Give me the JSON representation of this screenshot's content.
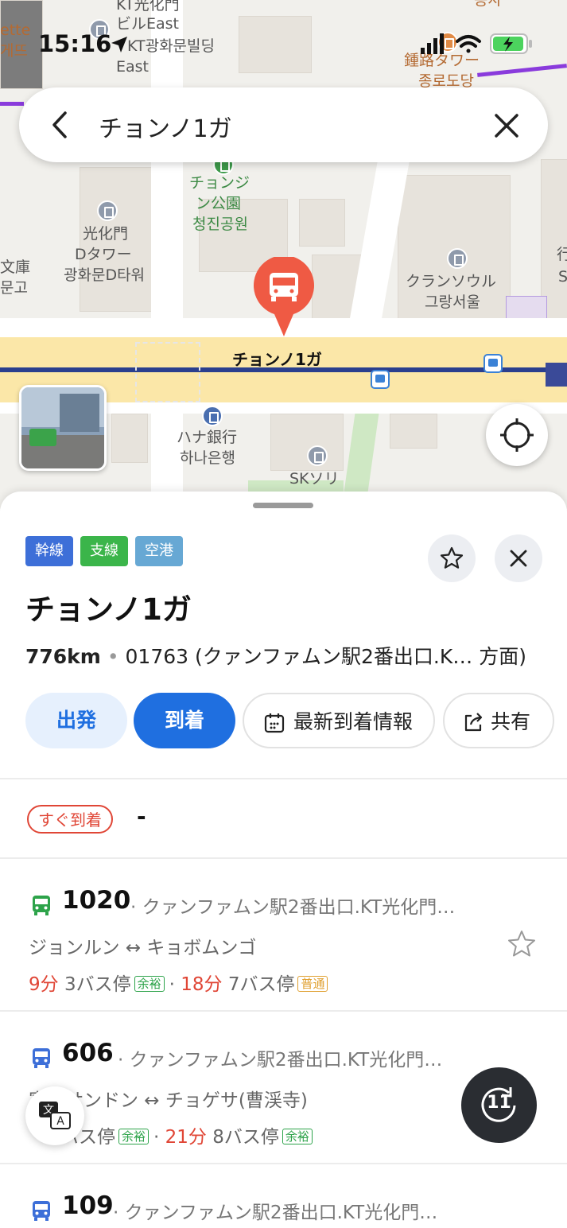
{
  "status": {
    "time": "15:16"
  },
  "search": {
    "query": "チョンノ1ガ"
  },
  "map": {
    "labels": {
      "kt_jp_top": "KT光化門",
      "kt_jp": "ビルEast",
      "kt_ko": "KT광화문빌딩",
      "kt_east": "East",
      "ette": "ette",
      "gate": "게뜨",
      "jongno_tower_jp": "鍾路タワー",
      "jongno_tower_ko": "종로도당",
      "jongno_top": "종자",
      "park_jp1": "チョンジ",
      "park_jp2": "ン公園",
      "park_ko": "청진공원",
      "dtower_jp1": "光化門",
      "dtower_jp2": "Dタワー",
      "dtower_ko": "광화문D타워",
      "library_jp": "文庫",
      "library_ko": "문고",
      "gran_jp": "クランソウル",
      "gran_ko": "그랑서울",
      "side_char": "行",
      "side_s": "S",
      "stop_pin_label": "チョンノ1ガ",
      "hana_jp": "ハナ銀行",
      "hana_ko": "하나은행",
      "sk": "SKソリ"
    }
  },
  "stop": {
    "tags": [
      {
        "label": "幹線",
        "color": "#3d6fd8"
      },
      {
        "label": "支線",
        "color": "#3bb54a"
      },
      {
        "label": "空港",
        "color": "#67a8d4"
      }
    ],
    "name": "チョンノ1ガ",
    "distance": "776km",
    "sep": " • ",
    "stop_id_direction": "01763 (クァンファムン駅2番出口.K… 方面)",
    "actions": {
      "depart": "出発",
      "arrive": "到着",
      "latest": "最新到着情報",
      "share": "共有"
    }
  },
  "arriving_soon": {
    "badge": "すぐ到着",
    "value": "-"
  },
  "routes": [
    {
      "number": "1020",
      "color": "#2da34a",
      "direction": "· クァンファムン駅2番出口.KT光化門…",
      "endpoints": "ジョンルン ↔ キョボムンゴ",
      "first_min": "9分",
      "first_stops": "3バス停",
      "first_level": "余裕",
      "second_min": "18分",
      "second_stops": "7バス停",
      "second_level": "普通"
    },
    {
      "number": "606",
      "color": "#3d6fd8",
      "direction": "· クァンファムン駅2番出口.KT光化門…",
      "endpoints": "富川サンドン ↔ チョゲサ(曹渓寺)",
      "first_min": "",
      "first_stops": "バス停",
      "first_level": "余裕",
      "second_min": "21分",
      "second_stops": "8バス停",
      "second_level": "余裕"
    },
    {
      "number": "109",
      "color": "#3d6fd8",
      "direction": "· クァンファムン駅2番出口.KT光化門…"
    }
  ],
  "refresh": {
    "count": "11"
  }
}
